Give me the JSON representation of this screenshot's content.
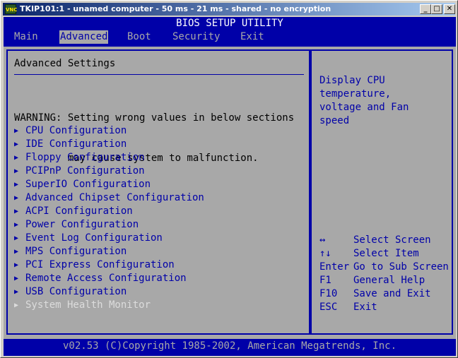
{
  "window": {
    "title": "TKIP101:1 - unamed computer - 50 ms - 21 ms - shared - no encryption",
    "icon_text": "VNC",
    "minimize": "_",
    "maximize": "□",
    "close": "✕"
  },
  "bios": {
    "header": "BIOS SETUP UTILITY",
    "tabs": [
      "Main",
      "Advanced",
      "Boot",
      "Security",
      "Exit"
    ],
    "active_tab": "Advanced",
    "section_title": "Advanced Settings",
    "warning_line1": "WARNING: Setting wrong values in below sections",
    "warning_line2": "         may cause system to malfunction.",
    "items": [
      {
        "label": "CPU Configuration",
        "enabled": true
      },
      {
        "label": "IDE Configuration",
        "enabled": true
      },
      {
        "label": "Floppy Configuration",
        "enabled": true
      },
      {
        "label": "PCIPnP Configuration",
        "enabled": true
      },
      {
        "label": "SuperIO Configuration",
        "enabled": true
      },
      {
        "label": "Advanced Chipset Configuration",
        "enabled": true
      },
      {
        "label": "ACPI Configuration",
        "enabled": true
      },
      {
        "label": "Power Configuration",
        "enabled": true
      },
      {
        "label": "Event Log Configuration",
        "enabled": true
      },
      {
        "label": "MPS Configuration",
        "enabled": true
      },
      {
        "label": "PCI Express Configuration",
        "enabled": true
      },
      {
        "label": "Remote Access Configuration",
        "enabled": true
      },
      {
        "label": "USB Configuration",
        "enabled": true
      },
      {
        "label": "System Health Monitor",
        "enabled": false
      }
    ],
    "item_arrow": "▶",
    "help": [
      "Display CPU",
      "temperature,",
      "voltage and Fan",
      "speed"
    ],
    "keys": [
      {
        "key": "↔",
        "action": "Select Screen"
      },
      {
        "key": "↑↓",
        "action": "Select Item"
      },
      {
        "key": "Enter",
        "action": "Go to Sub Screen"
      },
      {
        "key": "F1",
        "action": "General Help"
      },
      {
        "key": "F10",
        "action": "Save and Exit"
      },
      {
        "key": "ESC",
        "action": "Exit"
      }
    ],
    "footer": "v02.53 (C)Copyright 1985-2002, American Megatrends, Inc."
  },
  "colors": {
    "bios_blue": "#0000a8",
    "bios_gray": "#a8a8a8",
    "disabled_text": "#dcdcdc",
    "title_bar": "#0a246a"
  }
}
